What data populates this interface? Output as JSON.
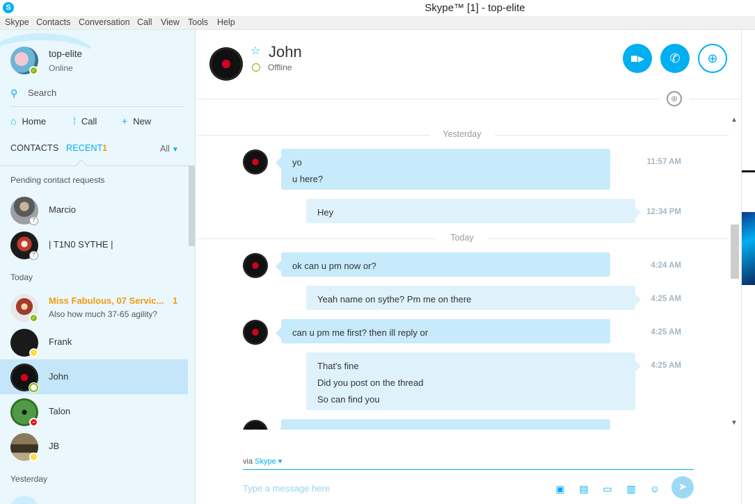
{
  "window": {
    "title": "Skype™ [1] - top-elite"
  },
  "menu": [
    "Skype",
    "Contacts",
    "Conversation",
    "Call",
    "View",
    "Tools",
    "Help"
  ],
  "me": {
    "name": "top-elite",
    "status": "Online"
  },
  "sidebar": {
    "search_label": "Search",
    "nav": {
      "home": "Home",
      "call": "Call",
      "new": "New"
    },
    "tabs": {
      "contacts": "CONTACTS",
      "recent": "RECENT",
      "recent_count": "1",
      "filter": "All"
    },
    "sections": {
      "pending": "Pending contact requests",
      "today": "Today",
      "yesterday": "Yesterday"
    },
    "pending": [
      {
        "name": "Marcio",
        "status": "unknown"
      },
      {
        "name": "| T1N0 SYTHE |",
        "status": "unknown"
      }
    ],
    "today": [
      {
        "name": "Miss Fabulous, 07 Servic...",
        "message": "Also how much 37-65 agility?",
        "unread": "1",
        "status": "online"
      },
      {
        "name": "Frank",
        "status": "away"
      },
      {
        "name": "John",
        "status": "offline",
        "selected": true
      },
      {
        "name": "Talon",
        "status": "dnd"
      },
      {
        "name": "JB",
        "status": "away"
      }
    ]
  },
  "conversation": {
    "contact": {
      "name": "John",
      "status": "Offline"
    },
    "days": {
      "yesterday": "Yesterday",
      "today": "Today"
    },
    "messages": [
      {
        "dir": "in",
        "lines": [
          "yo",
          "u here?"
        ],
        "time": "11:57 AM"
      },
      {
        "dir": "out",
        "lines": [
          "Hey"
        ],
        "time": "12:34 PM"
      },
      {
        "dir": "in",
        "lines": [
          "ok can u pm now or?"
        ],
        "time": "4:24 AM"
      },
      {
        "dir": "out",
        "lines": [
          "Yeah name on sythe? Pm me on there"
        ],
        "time": "4:25 AM"
      },
      {
        "dir": "in",
        "lines": [
          "can u pm me first? then ill reply or"
        ],
        "time": "4:25 AM"
      },
      {
        "dir": "out",
        "lines": [
          "That's fine",
          "Did you post on the thread",
          "So can find you"
        ],
        "time": "4:25 AM"
      }
    ],
    "via_label": "via",
    "via_service": "Skype",
    "composer_placeholder": "Type a message here"
  },
  "colors": {
    "accent": "#00aff0",
    "unread": "#f39c12",
    "sidebar_bg": "#eaf7fd",
    "bubble_in": "#c7ebfb",
    "bubble_out": "#dff2fc"
  },
  "icons": [
    "search-icon",
    "home-icon",
    "dialpad-icon",
    "plus-icon",
    "chevron-down-icon",
    "star-icon",
    "video-call-icon",
    "call-icon",
    "add-contact-icon",
    "globe-icon",
    "image-icon",
    "file-icon",
    "video-message-icon",
    "contact-card-icon",
    "emoticon-icon",
    "send-icon"
  ]
}
